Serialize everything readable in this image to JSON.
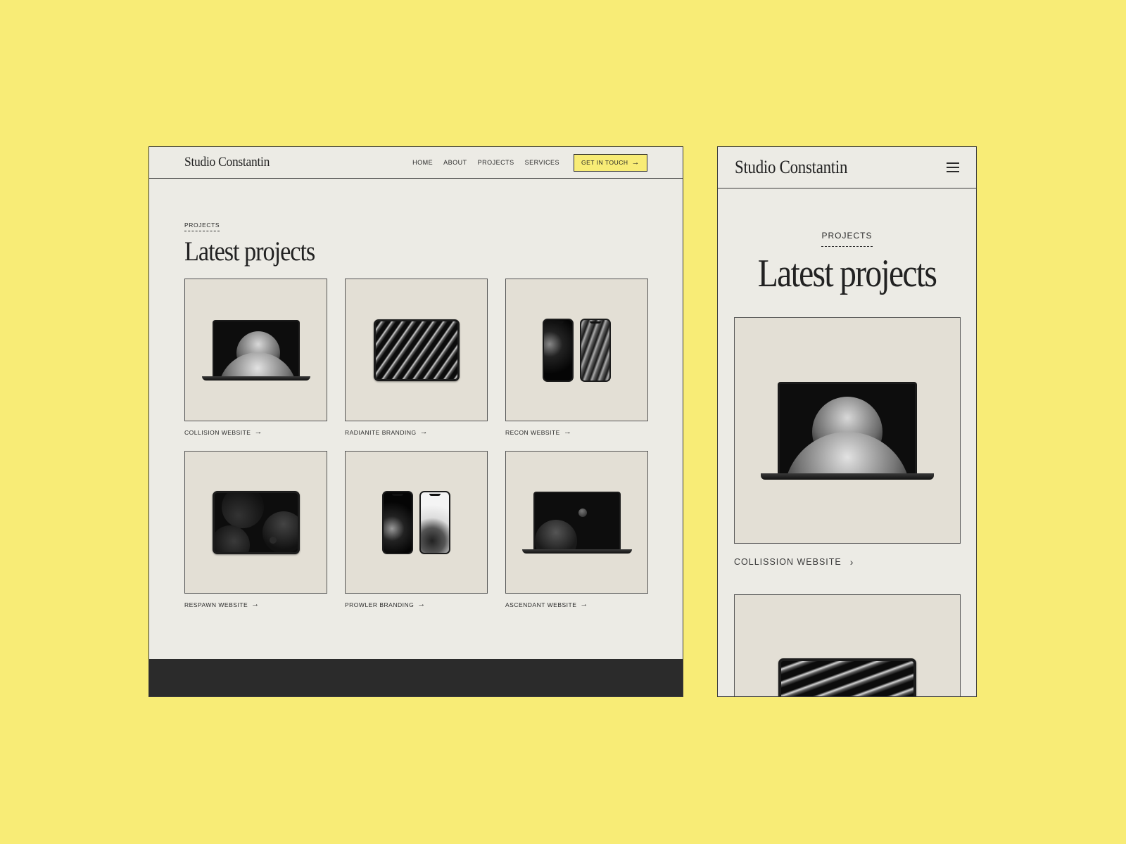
{
  "brand": "Studio Constantin",
  "nav": {
    "items": [
      "HOME",
      "ABOUT",
      "PROJECTS",
      "SERVICES"
    ],
    "cta_label": "GET IN TOUCH"
  },
  "section": {
    "eyebrow": "PROJECTS",
    "title": "Latest projects"
  },
  "projects": [
    {
      "label": "COLLISION WEBSITE",
      "device": "laptop"
    },
    {
      "label": "RADIANITE BRANDING",
      "device": "tablet"
    },
    {
      "label": "RECON WEBSITE",
      "device": "phones"
    },
    {
      "label": "RESPAWN WEBSITE",
      "device": "tablet"
    },
    {
      "label": "PROWLER BRANDING",
      "device": "phones"
    },
    {
      "label": "ASCENDANT WEBSITE",
      "device": "laptop"
    }
  ],
  "mobile": {
    "first_project_label": "COLLISSION WEBSITE"
  },
  "colors": {
    "background": "#F8EC76",
    "page": "#ECEBE5",
    "card": "#E3DFD5",
    "accent": "#F8EC76",
    "footer": "#2B2B2B"
  },
  "icons": [
    "arrow-right-icon",
    "chevron-right-icon",
    "menu-icon"
  ]
}
